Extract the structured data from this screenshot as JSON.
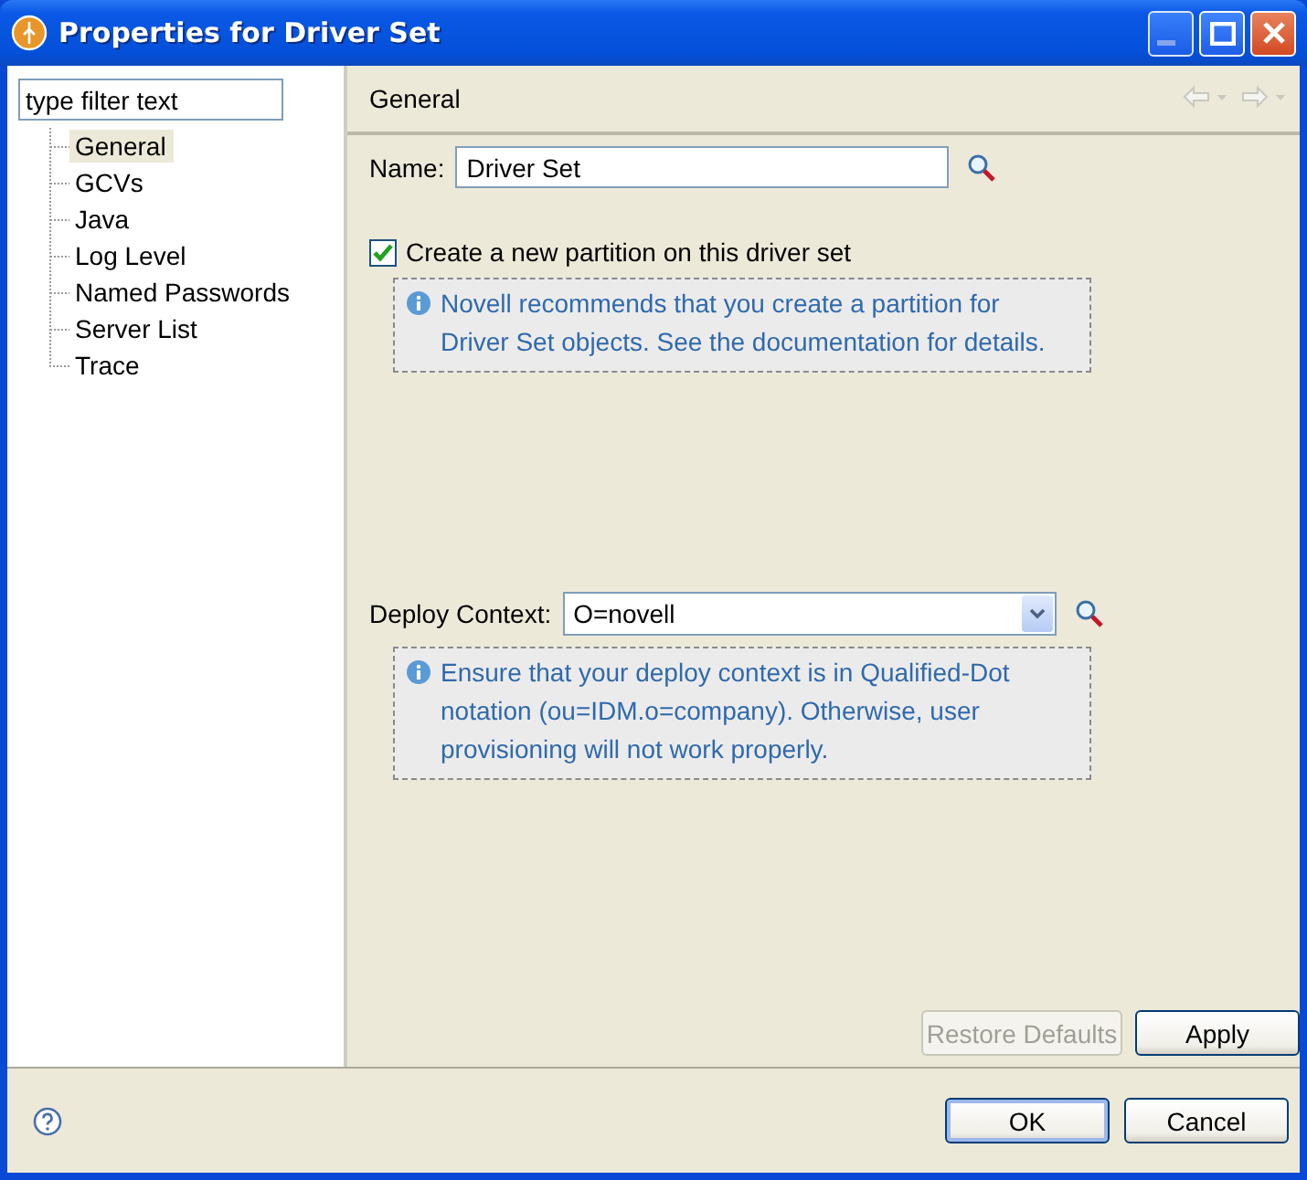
{
  "window": {
    "title": "Properties for Driver Set"
  },
  "filter": {
    "placeholder": "type filter text"
  },
  "nav": [
    {
      "label": "General",
      "selected": true
    },
    {
      "label": "GCVs",
      "selected": false
    },
    {
      "label": "Java",
      "selected": false
    },
    {
      "label": "Log Level",
      "selected": false
    },
    {
      "label": "Named Passwords",
      "selected": false
    },
    {
      "label": "Server List",
      "selected": false
    },
    {
      "label": "Trace",
      "selected": false
    }
  ],
  "page": {
    "title": "General"
  },
  "name_field": {
    "label": "Name:",
    "value": "Driver Set"
  },
  "partition": {
    "label": "Create a new partition on this driver set",
    "checked": true
  },
  "partition_note": "Novell recommends that you create a partition for Driver Set objects. See the documentation for details.",
  "context": {
    "label": "Deploy Context:",
    "value": "O=novell"
  },
  "context_note": "Ensure that your deploy context is in Qualified-Dot notation (ou=IDM.o=company). Otherwise, user provisioning will not work properly.",
  "page_buttons": [
    {
      "label": "Restore Defaults",
      "disabled": true
    },
    {
      "label": "Apply",
      "disabled": false
    }
  ],
  "dialog_buttons": [
    {
      "label": "OK",
      "default": true
    },
    {
      "label": "Cancel",
      "default": false
    }
  ]
}
